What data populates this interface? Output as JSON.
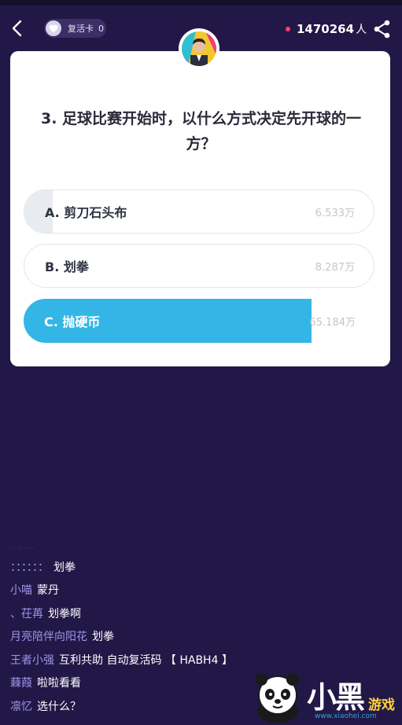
{
  "top_bar": {
    "revive_label": "复活卡",
    "revive_count": "0",
    "viewer_count": "1470264",
    "viewer_unit": "人"
  },
  "quiz": {
    "question": "3. 足球比赛开始时，以什么方式决定先开球的一方？",
    "options": [
      {
        "label": "A. 剪刀石头布",
        "count": "6.533万",
        "share": 0.08
      },
      {
        "label": "B. 划拳",
        "count": "8.287万",
        "share": 0.0
      },
      {
        "label": "C. 抛硬币",
        "count": "65.184万",
        "share": 0.82,
        "selected": true
      }
    ]
  },
  "chat": {
    "faded_line": "‥‥‥‥",
    "messages": [
      {
        "user": "：：：：：：",
        "text": "划拳"
      },
      {
        "user": "小喵",
        "text": "蒙丹"
      },
      {
        "user": "、茌苒",
        "text": "划拳啊"
      },
      {
        "user": "月亮陪伴向阳花",
        "text": "划拳"
      },
      {
        "user": "王者小强",
        "text": "互利共助 自动复活码 【 HABH4 】"
      },
      {
        "user": "蕀葭",
        "text": "啦啦看看"
      },
      {
        "user": "凛忆",
        "text": "选什么？"
      }
    ]
  },
  "watermark": {
    "brand": "小黑",
    "sub": "游戏",
    "url": "www.xiaohei.com"
  },
  "colors": {
    "background": "#221847",
    "accent": "#33b6e5",
    "live_dot": "#ff3d6e",
    "chat_user": "#9f95e8"
  },
  "icons": {
    "back": "chevron-left-icon",
    "revive": "heart-icon",
    "share": "share-icon"
  }
}
